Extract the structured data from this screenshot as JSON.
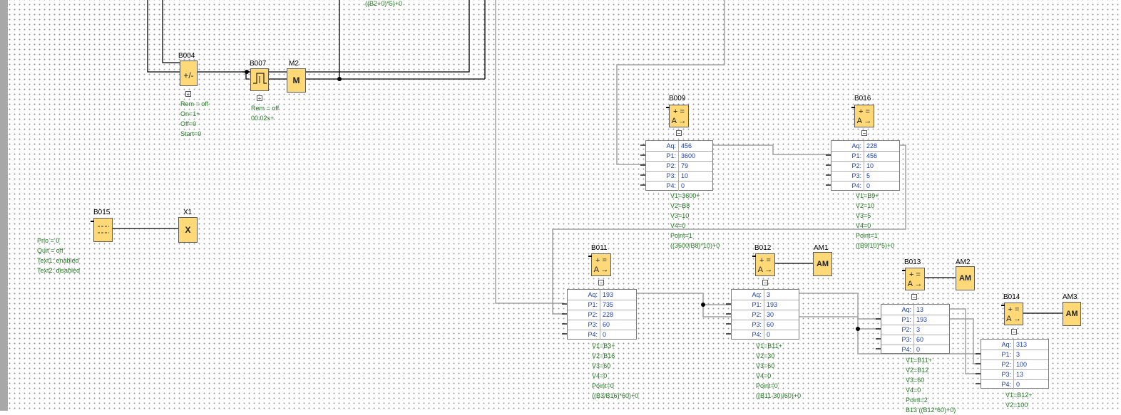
{
  "blocks": {
    "B004": {
      "label": "B004",
      "symbol": "+/-",
      "params": [
        "Rem = off",
        "On=1+",
        "Off=0",
        "Start=0"
      ]
    },
    "B007": {
      "label": "B007",
      "params": [
        "Rem = off",
        "00:02s+"
      ]
    },
    "M2": {
      "label": "M2",
      "symbol": "M"
    },
    "B015": {
      "label": "B015",
      "params": [
        "Prio = 0",
        "Quit = off",
        "Text1: enabled",
        "Text2: disabled"
      ]
    },
    "X1": {
      "label": "X1",
      "symbol": "X"
    },
    "top_formula": "((B2+0)*5)+0",
    "B009": {
      "label": "B009",
      "symbol": "A →",
      "rows": [
        [
          "Aq:",
          "456"
        ],
        [
          "P1:",
          "3600"
        ],
        [
          "P2:",
          "79"
        ],
        [
          "P3:",
          "10"
        ],
        [
          "P4:",
          "0"
        ]
      ],
      "params": [
        "V1=3600+",
        "V2=B8",
        "V3=10",
        "V4=0",
        "Point=1",
        "((3600/B8)*10)+0"
      ]
    },
    "B016": {
      "label": "B016",
      "symbol": "A →",
      "rows": [
        [
          "Aq:",
          "228"
        ],
        [
          "P1:",
          "456"
        ],
        [
          "P2:",
          "10"
        ],
        [
          "P3:",
          "5"
        ],
        [
          "P4:",
          "0"
        ]
      ],
      "params": [
        "V1=B9+",
        "V2=10",
        "V3=5",
        "V4=0",
        "Point=1",
        "((B9/10)*5)+0"
      ]
    },
    "B011": {
      "label": "B011",
      "symbol": "A →",
      "rows": [
        [
          "Aq:",
          "193"
        ],
        [
          "P1:",
          "735"
        ],
        [
          "P2:",
          "228"
        ],
        [
          "P3:",
          "60"
        ],
        [
          "P4:",
          "0"
        ]
      ],
      "params": [
        "V1=B3+",
        "V2=B16",
        "V3=60",
        "V4=0",
        "Point=0",
        "((B3/B16)*60)+0"
      ]
    },
    "B012": {
      "label": "B012",
      "symbol": "A →",
      "rows": [
        [
          "Aq:",
          "3"
        ],
        [
          "P1:",
          "193"
        ],
        [
          "P2:",
          "30"
        ],
        [
          "P3:",
          "60"
        ],
        [
          "P4:",
          "0"
        ]
      ],
      "params": [
        "V1=B11+",
        "V2=30",
        "V3=60",
        "V4=0",
        "Point=0",
        "((B11-30)/60)+0"
      ]
    },
    "B013": {
      "label": "B013",
      "symbol": "A →",
      "rows": [
        [
          "Aq:",
          "13"
        ],
        [
          "P1:",
          "193"
        ],
        [
          "P2:",
          "3"
        ],
        [
          "P3:",
          "60"
        ],
        [
          "P4:",
          "0"
        ]
      ],
      "params": [
        "V1=B11+",
        "V2=B12",
        "V3=60",
        "V4=0",
        "Point=2",
        "B13 ((B12*60)+0)"
      ]
    },
    "B014": {
      "label": "B014",
      "symbol": "A →",
      "rows": [
        [
          "Aq:",
          "313"
        ],
        [
          "P1:",
          "3"
        ],
        [
          "P2:",
          "100"
        ],
        [
          "P3:",
          "13"
        ],
        [
          "P4:",
          "0"
        ]
      ],
      "params": [
        "V1=B12+",
        "V2=100"
      ]
    },
    "AM1": {
      "label": "AM1",
      "symbol": "AM"
    },
    "AM2": {
      "label": "AM2",
      "symbol": "AM"
    },
    "AM3": {
      "label": "AM3",
      "symbol": "AM"
    }
  }
}
